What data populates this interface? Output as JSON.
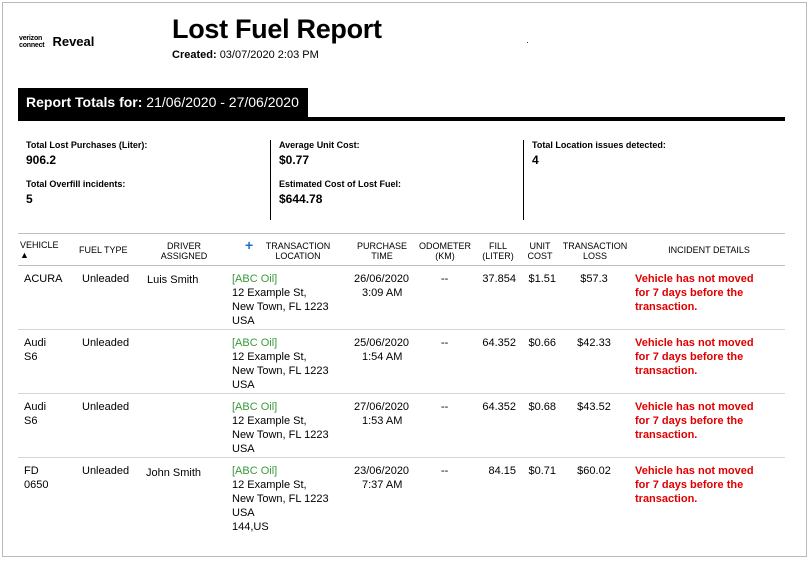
{
  "brand": {
    "line1": "verizon",
    "line2": "connect",
    "product": "Reveal"
  },
  "report": {
    "title": "Lost Fuel Report",
    "created_label": "Created:",
    "created_value": "03/07/2020 2:03 PM"
  },
  "totals": {
    "label": "Report Totals for:",
    "range": "21/06/2020 - 27/06/2020"
  },
  "summary": {
    "lost_purchases_label": "Total Lost Purchases (Liter):",
    "lost_purchases_value": "906.2",
    "overfill_label": "Total Overfill incidents:",
    "overfill_value": "5",
    "avg_cost_label": "Average Unit Cost:",
    "avg_cost_value": "$0.77",
    "est_cost_label": "Estimated Cost of Lost Fuel:",
    "est_cost_value": "$644.78",
    "location_label": "Total Location issues detected:",
    "location_value": "4"
  },
  "columns": {
    "vehicle": "VEHICLE",
    "sort_icon": "▲",
    "fuel_type": "FUEL TYPE",
    "driver_1": "DRIVER",
    "driver_2": "ASSIGNED",
    "location_1": "TRANSACTION",
    "location_2": "LOCATION",
    "time_1": "PURCHASE",
    "time_2": "TIME",
    "odometer_1": "ODOMETER",
    "odometer_2": "(KM)",
    "fill_1": "FILL",
    "fill_2": "(LITER)",
    "cost_1": "UNIT",
    "cost_2": "COST",
    "loss_1": "TRANSACTION",
    "loss_2": "LOSS",
    "incident": "INCIDENT DETAILS"
  },
  "rows": [
    {
      "vehicle_1": "ACURA",
      "vehicle_2": "",
      "fuel": "Unleaded",
      "driver": "Luis Smith",
      "loc_name": "[ABC Oil]",
      "loc_1": "12 Example St,",
      "loc_2": "New Town, FL 1223",
      "loc_3": "USA",
      "loc_4": "",
      "date": "26/06/2020",
      "time": "3:09 AM",
      "odometer": "--",
      "fill": "37.854",
      "cost": "$1.51",
      "loss": "$57.3",
      "inc_1": "Vehicle has not moved",
      "inc_2": "for 7 days before the",
      "inc_3": "transaction."
    },
    {
      "vehicle_1": "Audi",
      "vehicle_2": "S6",
      "fuel": "Unleaded",
      "driver": "",
      "loc_name": "[ABC Oil]",
      "loc_1": "12 Example St,",
      "loc_2": "New Town, FL 1223",
      "loc_3": "USA",
      "loc_4": "",
      "date": "25/06/2020",
      "time": "1:54 AM",
      "odometer": "--",
      "fill": "64.352",
      "cost": "$0.66",
      "loss": "$42.33",
      "inc_1": "Vehicle has not moved",
      "inc_2": "for 7 days before the",
      "inc_3": "transaction."
    },
    {
      "vehicle_1": "Audi",
      "vehicle_2": "S6",
      "fuel": "Unleaded",
      "driver": "",
      "loc_name": "[ABC Oil]",
      "loc_1": "12 Example St,",
      "loc_2": "New Town, FL 1223",
      "loc_3": "USA",
      "loc_4": "",
      "date": "27/06/2020",
      "time": "1:53 AM",
      "odometer": "--",
      "fill": "64.352",
      "cost": "$0.68",
      "loss": "$43.52",
      "inc_1": "Vehicle has not moved",
      "inc_2": "for 7 days before the",
      "inc_3": "transaction."
    },
    {
      "vehicle_1": "FD",
      "vehicle_2": "0650",
      "fuel": "Unleaded",
      "driver": "John Smith",
      "loc_name": "[ABC Oil]",
      "loc_1": "12 Example St,",
      "loc_2": "New Town, FL 1223",
      "loc_3": "USA",
      "loc_4": "144,US",
      "date": "23/06/2020",
      "time": "7:37 AM",
      "odometer": "--",
      "fill": "84.15",
      "cost": "$0.71",
      "loss": "$60.02",
      "inc_1": "Vehicle has not moved",
      "inc_2": "for 7 days before the",
      "inc_3": "transaction."
    }
  ]
}
